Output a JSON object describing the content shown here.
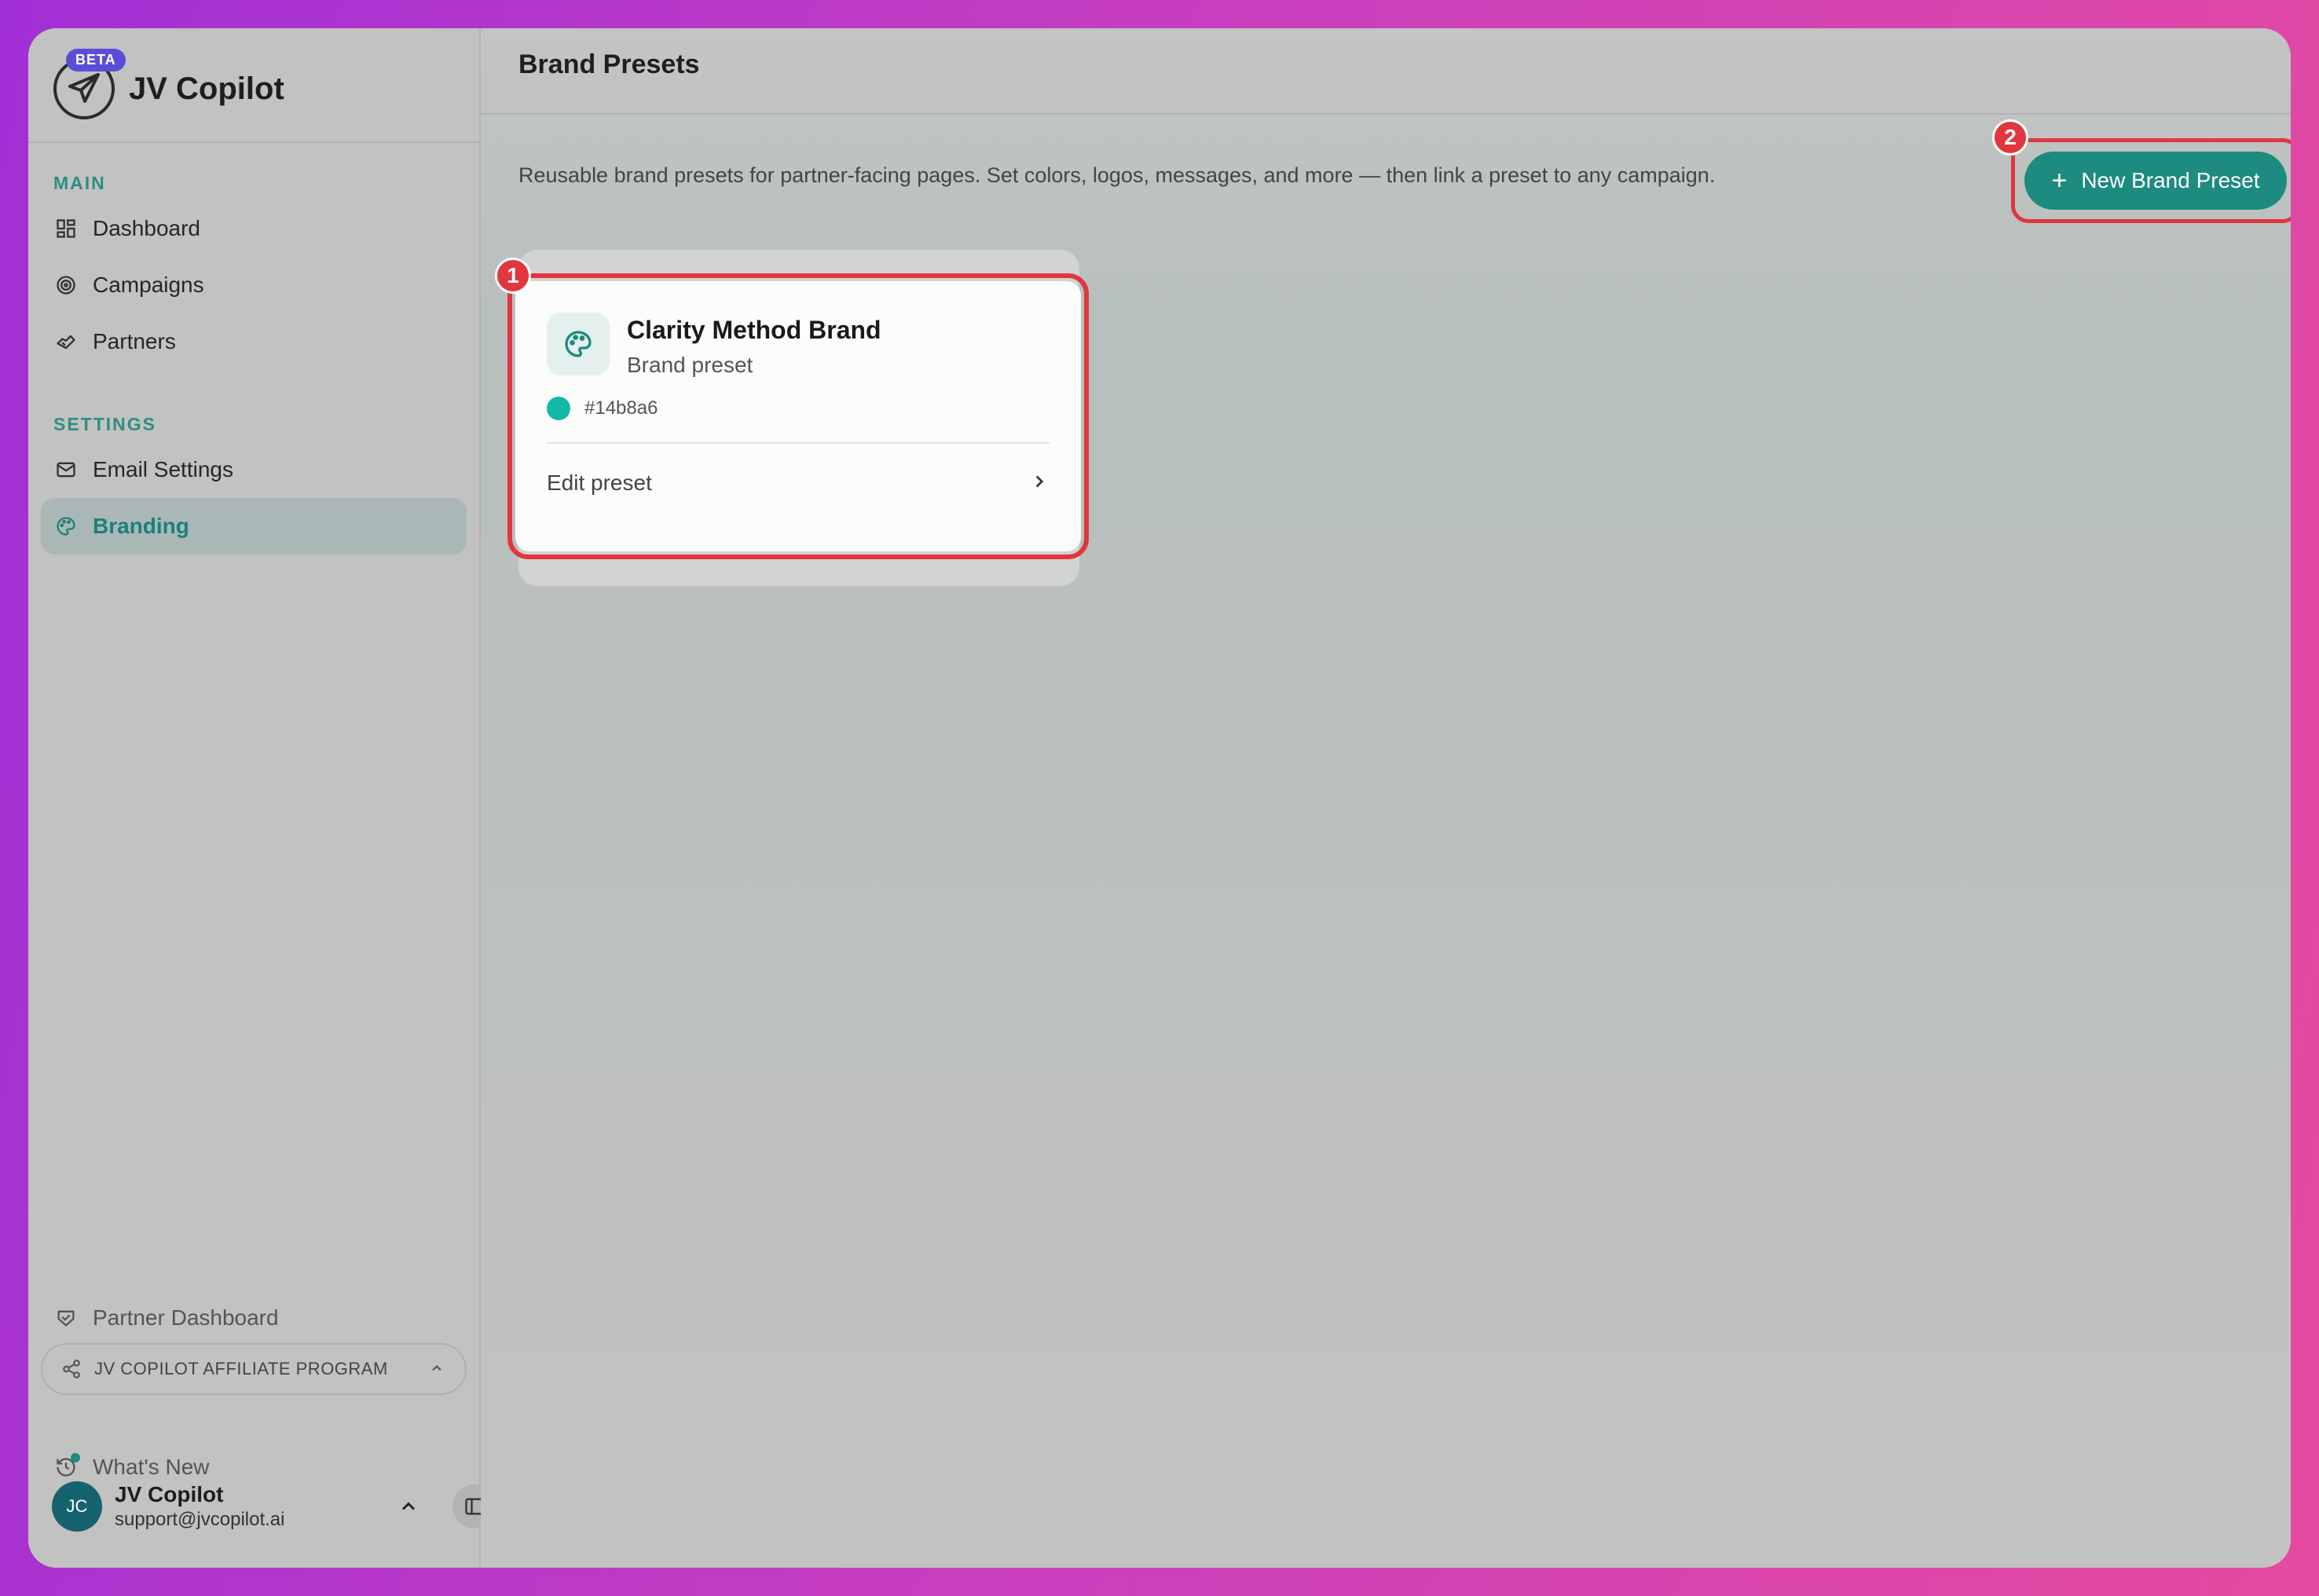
{
  "app": {
    "name": "JV Copilot",
    "beta_label": "BETA"
  },
  "sidebar": {
    "main_label": "MAIN",
    "main_items": [
      {
        "label": "Dashboard",
        "icon": "grid-icon"
      },
      {
        "label": "Campaigns",
        "icon": "target-icon"
      },
      {
        "label": "Partners",
        "icon": "handshake-icon"
      }
    ],
    "settings_label": "SETTINGS",
    "settings_items": [
      {
        "label": "Email Settings",
        "icon": "mail-icon"
      },
      {
        "label": "Branding",
        "icon": "palette-icon",
        "active": true
      }
    ],
    "partner_dashboard": "Partner Dashboard",
    "affiliate_program": "JV COPILOT AFFILIATE PROGRAM",
    "whats_new": "What's New",
    "user": {
      "initials": "JC",
      "name": "JV Copilot",
      "email": "support@jvcopilot.ai"
    }
  },
  "main": {
    "title": "Brand Presets",
    "description": "Reusable brand presets for partner-facing pages. Set colors, logos, messages, and more — then link a preset to any campaign.",
    "new_button_label": "New Brand Preset",
    "presets": [
      {
        "name": "Clarity Method Brand",
        "subtitle": "Brand preset",
        "color": "#14b8a6",
        "color_label": "#14b8a6",
        "action_label": "Edit preset"
      }
    ]
  },
  "annotations": {
    "badge_1": "1",
    "badge_2": "2"
  },
  "colors": {
    "accent": "#1d8b7f",
    "annotation": "#e1363f",
    "preset_swatch": "#14b8a6"
  }
}
